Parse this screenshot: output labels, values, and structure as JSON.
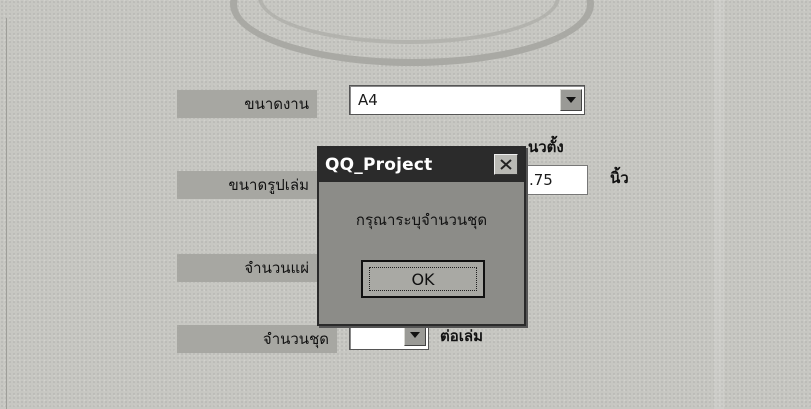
{
  "dialog": {
    "title": "QQ_Project",
    "message": "กรุณาระบุจำนวนชุด",
    "ok_label": "OK"
  },
  "form": {
    "paper_size_label": "ขนาดงาน",
    "paper_size_value": "A4",
    "book_size_label": "ขนาดรูปเล่ม",
    "orientation_text": "นวตั้ง",
    "book_size_value": ".75",
    "unit_text": "นิ้ว",
    "sheets_label": "จำนวนแผ่",
    "sets_label": "จำนวนชุด",
    "sets_value": "",
    "per_volume_text": "ต่อเล่ม"
  },
  "colors": {
    "background": "#c7c7c2",
    "label_bg": "#a7a7a2",
    "dialog_bg": "#8c8c88",
    "titlebar": "#2b2b2b"
  },
  "icons": {
    "dropdown": "chevron-down-icon",
    "close": "close-icon"
  }
}
